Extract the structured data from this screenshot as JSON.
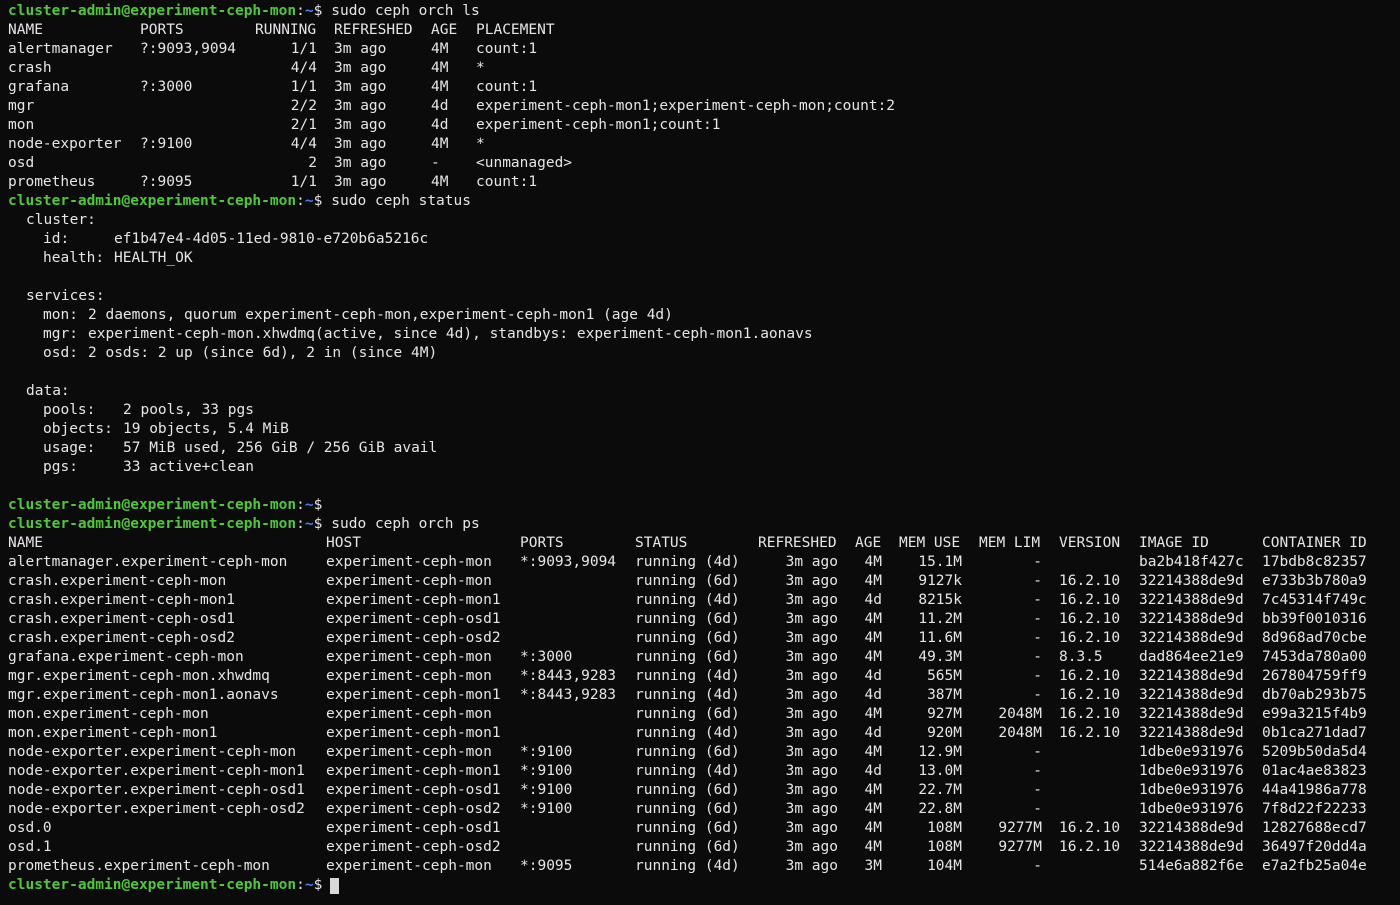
{
  "colors": {
    "background": "#0b0b0b",
    "text": "#e6e6e6",
    "prompt_user": "#4ec936",
    "prompt_path": "#4d7dff",
    "cursor": "#d8d8d8"
  },
  "prompt": {
    "user_host": "cluster-admin@experiment-ceph-mon",
    "separator": ":",
    "path": "~",
    "symbol": "$"
  },
  "commands": {
    "orch_ls": "sudo ceph orch ls",
    "status": "sudo ceph status",
    "orch_ps": "sudo ceph orch ps"
  },
  "orch_ls": {
    "headers": [
      "NAME",
      "PORTS",
      "RUNNING",
      "REFRESHED",
      "AGE",
      "PLACEMENT"
    ],
    "rows": [
      [
        "alertmanager",
        "?:9093,9094",
        "1/1",
        "3m ago",
        "4M",
        "count:1"
      ],
      [
        "crash",
        "",
        "4/4",
        "3m ago",
        "4M",
        "*"
      ],
      [
        "grafana",
        "?:3000",
        "1/1",
        "3m ago",
        "4M",
        "count:1"
      ],
      [
        "mgr",
        "",
        "2/2",
        "3m ago",
        "4d",
        "experiment-ceph-mon1;experiment-ceph-mon;count:2"
      ],
      [
        "mon",
        "",
        "2/1",
        "3m ago",
        "4d",
        "experiment-ceph-mon1;count:1"
      ],
      [
        "node-exporter",
        "?:9100",
        "4/4",
        "3m ago",
        "4M",
        "*"
      ],
      [
        "osd",
        "",
        "2",
        "3m ago",
        "-",
        "<unmanaged>"
      ],
      [
        "prometheus",
        "?:9095",
        "1/1",
        "3m ago",
        "4M",
        "count:1"
      ]
    ]
  },
  "ceph_status": {
    "cluster_label": "cluster:",
    "id_label": "id:",
    "id_value": "ef1b47e4-4d05-11ed-9810-e720b6a5216c",
    "health_label": "health:",
    "health_value": "HEALTH_OK",
    "services_label": "services:",
    "mon_label": "mon:",
    "mon_value": "2 daemons, quorum experiment-ceph-mon,experiment-ceph-mon1 (age 4d)",
    "mgr_label": "mgr:",
    "mgr_value": "experiment-ceph-mon.xhwdmq(active, since 4d), standbys: experiment-ceph-mon1.aonavs",
    "osd_label": "osd:",
    "osd_value": "2 osds: 2 up (since 6d), 2 in (since 4M)",
    "data_label": "data:",
    "pools_label": "pools:",
    "pools_value": "2 pools, 33 pgs",
    "objects_label": "objects:",
    "objects_value": "19 objects, 5.4 MiB",
    "usage_label": "usage:",
    "usage_value": "57 MiB used, 256 GiB / 256 GiB avail",
    "pgs_label": "pgs:",
    "pgs_value": "33 active+clean"
  },
  "orch_ps": {
    "headers": [
      "NAME",
      "HOST",
      "PORTS",
      "STATUS",
      "REFRESHED",
      "AGE",
      "MEM USE",
      "MEM LIM",
      "VERSION",
      "IMAGE ID",
      "CONTAINER ID"
    ],
    "rows": [
      [
        "alertmanager.experiment-ceph-mon",
        "experiment-ceph-mon",
        "*:9093,9094",
        "running (4d)",
        "3m ago",
        "4M",
        "15.1M",
        "-",
        "",
        "ba2b418f427c",
        "17bdb8c82357"
      ],
      [
        "crash.experiment-ceph-mon",
        "experiment-ceph-mon",
        "",
        "running (6d)",
        "3m ago",
        "4M",
        "9127k",
        "-",
        "16.2.10",
        "32214388de9d",
        "e733b3b780a9"
      ],
      [
        "crash.experiment-ceph-mon1",
        "experiment-ceph-mon1",
        "",
        "running (4d)",
        "3m ago",
        "4d",
        "8215k",
        "-",
        "16.2.10",
        "32214388de9d",
        "7c45314f749c"
      ],
      [
        "crash.experiment-ceph-osd1",
        "experiment-ceph-osd1",
        "",
        "running (6d)",
        "3m ago",
        "4M",
        "11.2M",
        "-",
        "16.2.10",
        "32214388de9d",
        "bb39f0010316"
      ],
      [
        "crash.experiment-ceph-osd2",
        "experiment-ceph-osd2",
        "",
        "running (6d)",
        "3m ago",
        "4M",
        "11.6M",
        "-",
        "16.2.10",
        "32214388de9d",
        "8d968ad70cbe"
      ],
      [
        "grafana.experiment-ceph-mon",
        "experiment-ceph-mon",
        "*:3000",
        "running (6d)",
        "3m ago",
        "4M",
        "49.3M",
        "-",
        "8.3.5",
        "dad864ee21e9",
        "7453da780a00"
      ],
      [
        "mgr.experiment-ceph-mon.xhwdmq",
        "experiment-ceph-mon",
        "*:8443,9283",
        "running (4d)",
        "3m ago",
        "4d",
        "565M",
        "-",
        "16.2.10",
        "32214388de9d",
        "267804759ff9"
      ],
      [
        "mgr.experiment-ceph-mon1.aonavs",
        "experiment-ceph-mon1",
        "*:8443,9283",
        "running (4d)",
        "3m ago",
        "4d",
        "387M",
        "-",
        "16.2.10",
        "32214388de9d",
        "db70ab293b75"
      ],
      [
        "mon.experiment-ceph-mon",
        "experiment-ceph-mon",
        "",
        "running (6d)",
        "3m ago",
        "4M",
        "927M",
        "2048M",
        "16.2.10",
        "32214388de9d",
        "e99a3215f4b9"
      ],
      [
        "mon.experiment-ceph-mon1",
        "experiment-ceph-mon1",
        "",
        "running (4d)",
        "3m ago",
        "4d",
        "920M",
        "2048M",
        "16.2.10",
        "32214388de9d",
        "0b1ca271dad7"
      ],
      [
        "node-exporter.experiment-ceph-mon",
        "experiment-ceph-mon",
        "*:9100",
        "running (6d)",
        "3m ago",
        "4M",
        "12.9M",
        "-",
        "",
        "1dbe0e931976",
        "5209b50da5d4"
      ],
      [
        "node-exporter.experiment-ceph-mon1",
        "experiment-ceph-mon1",
        "*:9100",
        "running (4d)",
        "3m ago",
        "4d",
        "13.0M",
        "-",
        "",
        "1dbe0e931976",
        "01ac4ae83823"
      ],
      [
        "node-exporter.experiment-ceph-osd1",
        "experiment-ceph-osd1",
        "*:9100",
        "running (6d)",
        "3m ago",
        "4M",
        "22.7M",
        "-",
        "",
        "1dbe0e931976",
        "44a41986a778"
      ],
      [
        "node-exporter.experiment-ceph-osd2",
        "experiment-ceph-osd2",
        "*:9100",
        "running (6d)",
        "3m ago",
        "4M",
        "22.8M",
        "-",
        "",
        "1dbe0e931976",
        "7f8d22f22233"
      ],
      [
        "osd.0",
        "experiment-ceph-osd1",
        "",
        "running (6d)",
        "3m ago",
        "4M",
        "108M",
        "9277M",
        "16.2.10",
        "32214388de9d",
        "12827688ecd7"
      ],
      [
        "osd.1",
        "experiment-ceph-osd2",
        "",
        "running (6d)",
        "3m ago",
        "4M",
        "108M",
        "9277M",
        "16.2.10",
        "32214388de9d",
        "36497f20dd4a"
      ],
      [
        "prometheus.experiment-ceph-mon",
        "experiment-ceph-mon",
        "*:9095",
        "running (4d)",
        "3m ago",
        "3M",
        "104M",
        "-",
        "",
        "514e6a882f6e",
        "e7a2fb25a04e"
      ]
    ]
  }
}
